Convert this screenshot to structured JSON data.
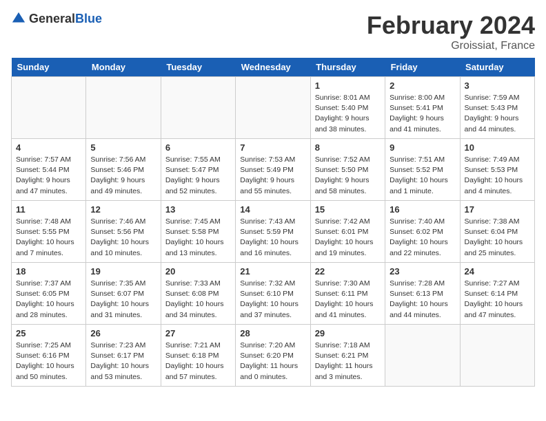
{
  "header": {
    "logo_general": "General",
    "logo_blue": "Blue",
    "month_title": "February 2024",
    "location": "Groissiat, France"
  },
  "days_of_week": [
    "Sunday",
    "Monday",
    "Tuesday",
    "Wednesday",
    "Thursday",
    "Friday",
    "Saturday"
  ],
  "weeks": [
    [
      {
        "day": "",
        "info": ""
      },
      {
        "day": "",
        "info": ""
      },
      {
        "day": "",
        "info": ""
      },
      {
        "day": "",
        "info": ""
      },
      {
        "day": "1",
        "info": "Sunrise: 8:01 AM\nSunset: 5:40 PM\nDaylight: 9 hours\nand 38 minutes."
      },
      {
        "day": "2",
        "info": "Sunrise: 8:00 AM\nSunset: 5:41 PM\nDaylight: 9 hours\nand 41 minutes."
      },
      {
        "day": "3",
        "info": "Sunrise: 7:59 AM\nSunset: 5:43 PM\nDaylight: 9 hours\nand 44 minutes."
      }
    ],
    [
      {
        "day": "4",
        "info": "Sunrise: 7:57 AM\nSunset: 5:44 PM\nDaylight: 9 hours\nand 47 minutes."
      },
      {
        "day": "5",
        "info": "Sunrise: 7:56 AM\nSunset: 5:46 PM\nDaylight: 9 hours\nand 49 minutes."
      },
      {
        "day": "6",
        "info": "Sunrise: 7:55 AM\nSunset: 5:47 PM\nDaylight: 9 hours\nand 52 minutes."
      },
      {
        "day": "7",
        "info": "Sunrise: 7:53 AM\nSunset: 5:49 PM\nDaylight: 9 hours\nand 55 minutes."
      },
      {
        "day": "8",
        "info": "Sunrise: 7:52 AM\nSunset: 5:50 PM\nDaylight: 9 hours\nand 58 minutes."
      },
      {
        "day": "9",
        "info": "Sunrise: 7:51 AM\nSunset: 5:52 PM\nDaylight: 10 hours\nand 1 minute."
      },
      {
        "day": "10",
        "info": "Sunrise: 7:49 AM\nSunset: 5:53 PM\nDaylight: 10 hours\nand 4 minutes."
      }
    ],
    [
      {
        "day": "11",
        "info": "Sunrise: 7:48 AM\nSunset: 5:55 PM\nDaylight: 10 hours\nand 7 minutes."
      },
      {
        "day": "12",
        "info": "Sunrise: 7:46 AM\nSunset: 5:56 PM\nDaylight: 10 hours\nand 10 minutes."
      },
      {
        "day": "13",
        "info": "Sunrise: 7:45 AM\nSunset: 5:58 PM\nDaylight: 10 hours\nand 13 minutes."
      },
      {
        "day": "14",
        "info": "Sunrise: 7:43 AM\nSunset: 5:59 PM\nDaylight: 10 hours\nand 16 minutes."
      },
      {
        "day": "15",
        "info": "Sunrise: 7:42 AM\nSunset: 6:01 PM\nDaylight: 10 hours\nand 19 minutes."
      },
      {
        "day": "16",
        "info": "Sunrise: 7:40 AM\nSunset: 6:02 PM\nDaylight: 10 hours\nand 22 minutes."
      },
      {
        "day": "17",
        "info": "Sunrise: 7:38 AM\nSunset: 6:04 PM\nDaylight: 10 hours\nand 25 minutes."
      }
    ],
    [
      {
        "day": "18",
        "info": "Sunrise: 7:37 AM\nSunset: 6:05 PM\nDaylight: 10 hours\nand 28 minutes."
      },
      {
        "day": "19",
        "info": "Sunrise: 7:35 AM\nSunset: 6:07 PM\nDaylight: 10 hours\nand 31 minutes."
      },
      {
        "day": "20",
        "info": "Sunrise: 7:33 AM\nSunset: 6:08 PM\nDaylight: 10 hours\nand 34 minutes."
      },
      {
        "day": "21",
        "info": "Sunrise: 7:32 AM\nSunset: 6:10 PM\nDaylight: 10 hours\nand 37 minutes."
      },
      {
        "day": "22",
        "info": "Sunrise: 7:30 AM\nSunset: 6:11 PM\nDaylight: 10 hours\nand 41 minutes."
      },
      {
        "day": "23",
        "info": "Sunrise: 7:28 AM\nSunset: 6:13 PM\nDaylight: 10 hours\nand 44 minutes."
      },
      {
        "day": "24",
        "info": "Sunrise: 7:27 AM\nSunset: 6:14 PM\nDaylight: 10 hours\nand 47 minutes."
      }
    ],
    [
      {
        "day": "25",
        "info": "Sunrise: 7:25 AM\nSunset: 6:16 PM\nDaylight: 10 hours\nand 50 minutes."
      },
      {
        "day": "26",
        "info": "Sunrise: 7:23 AM\nSunset: 6:17 PM\nDaylight: 10 hours\nand 53 minutes."
      },
      {
        "day": "27",
        "info": "Sunrise: 7:21 AM\nSunset: 6:18 PM\nDaylight: 10 hours\nand 57 minutes."
      },
      {
        "day": "28",
        "info": "Sunrise: 7:20 AM\nSunset: 6:20 PM\nDaylight: 11 hours\nand 0 minutes."
      },
      {
        "day": "29",
        "info": "Sunrise: 7:18 AM\nSunset: 6:21 PM\nDaylight: 11 hours\nand 3 minutes."
      },
      {
        "day": "",
        "info": ""
      },
      {
        "day": "",
        "info": ""
      }
    ]
  ]
}
